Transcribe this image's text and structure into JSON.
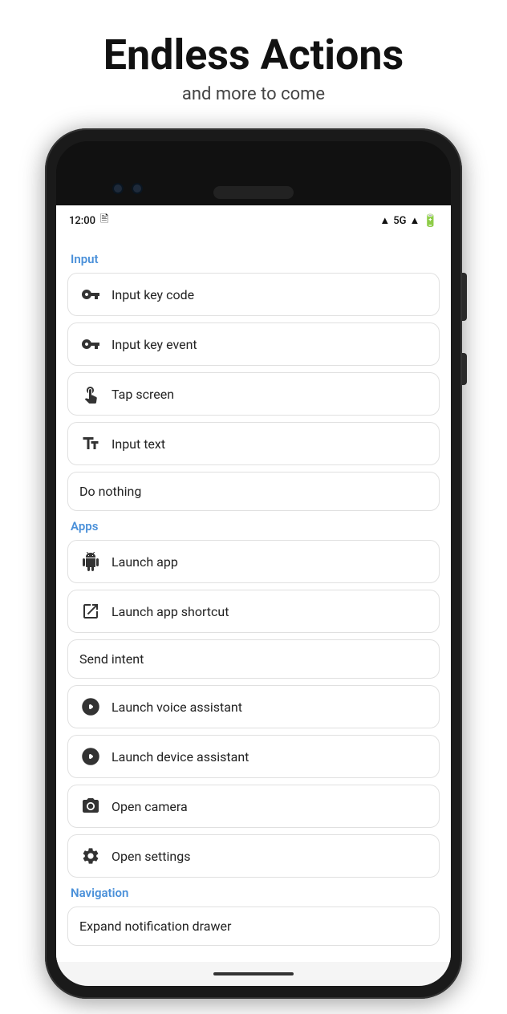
{
  "header": {
    "title": "Endless Actions",
    "subtitle": "and more to come"
  },
  "phone": {
    "status_bar": {
      "time": "12:00",
      "signal": "5G"
    },
    "sections": [
      {
        "id": "input",
        "label": "Input",
        "items": [
          {
            "id": "input-key-code",
            "label": "Input key code",
            "has_icon": true,
            "icon": "key-icon"
          },
          {
            "id": "input-key-event",
            "label": "Input key event",
            "has_icon": true,
            "icon": "key-icon"
          },
          {
            "id": "tap-screen",
            "label": "Tap screen",
            "has_icon": true,
            "icon": "touch-icon"
          },
          {
            "id": "input-text",
            "label": "Input text",
            "has_icon": true,
            "icon": "text-icon"
          },
          {
            "id": "do-nothing",
            "label": "Do nothing",
            "has_icon": false,
            "icon": ""
          }
        ]
      },
      {
        "id": "apps",
        "label": "Apps",
        "items": [
          {
            "id": "launch-app",
            "label": "Launch app",
            "has_icon": true,
            "icon": "android-icon"
          },
          {
            "id": "launch-app-shortcut",
            "label": "Launch app shortcut",
            "has_icon": true,
            "icon": "shortcut-icon"
          },
          {
            "id": "send-intent",
            "label": "Send intent",
            "has_icon": false,
            "icon": ""
          },
          {
            "id": "launch-voice-assistant",
            "label": "Launch voice assistant",
            "has_icon": true,
            "icon": "assistant-icon"
          },
          {
            "id": "launch-device-assistant",
            "label": "Launch device assistant",
            "has_icon": true,
            "icon": "assistant-icon"
          },
          {
            "id": "open-camera",
            "label": "Open camera",
            "has_icon": true,
            "icon": "camera-icon"
          },
          {
            "id": "open-settings",
            "label": "Open settings",
            "has_icon": true,
            "icon": "settings-icon"
          }
        ]
      },
      {
        "id": "navigation",
        "label": "Navigation",
        "items": [
          {
            "id": "expand-notification-drawer",
            "label": "Expand notification drawer",
            "has_icon": false,
            "icon": ""
          }
        ]
      }
    ]
  }
}
